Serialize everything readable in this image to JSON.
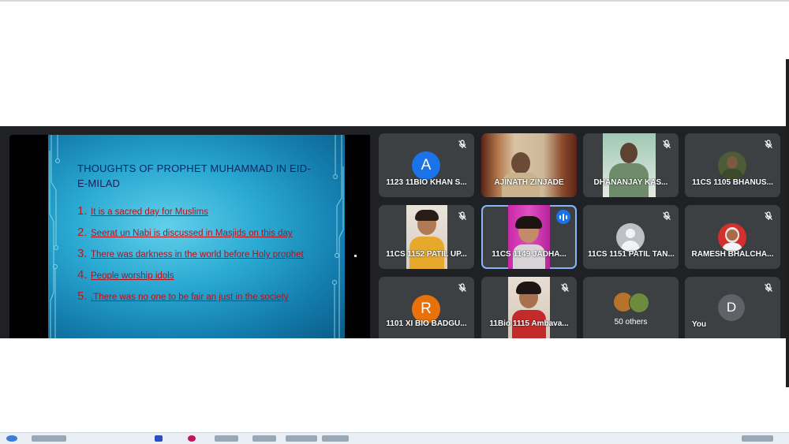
{
  "slide": {
    "title": "THOUGHTS OF PROPHET MUHAMMAD IN EID-E-MILAD",
    "points": [
      {
        "num": "1.",
        "text": "It is a sacred day for Muslims"
      },
      {
        "num": "2.",
        "text": "Seerat un Nabi is discussed in Masjids on this day"
      },
      {
        "num": "3.",
        "text": "There was darkness in the world before Holy prophet"
      },
      {
        "num": "4.",
        "text": "People worship idols"
      },
      {
        "num": "5.",
        "text": ".There was no one to be fair an just in the society"
      }
    ]
  },
  "participants": [
    {
      "name": "1123 11BIO KHAN S...",
      "initial": "A",
      "color": "#1a73e8",
      "muted": true
    },
    {
      "name": "AJINATH ZINJADE",
      "muted": false
    },
    {
      "name": "DHANANJAY KAS...",
      "muted": true
    },
    {
      "name": "11CS 1105 BHANUS...",
      "muted": true
    },
    {
      "name": "11CS 1152 PATIL UP...",
      "muted": true
    },
    {
      "name": "11CS 1149 JADHA...",
      "speaking": true
    },
    {
      "name": "11CS 1151 PATIL TAN...",
      "muted": true
    },
    {
      "name": "RAMESH BHALCHA...",
      "muted": true
    },
    {
      "name": "1101 XI BIO BADGU...",
      "initial": "R",
      "color": "#e8710a",
      "muted": true
    },
    {
      "name": "11Bio 1115 Ambava...",
      "muted": true
    },
    {
      "name": "50 others"
    },
    {
      "name": "You",
      "initial": "D",
      "color": "#5f6368",
      "muted": true
    }
  ],
  "icons": [
    "mic-off-icon",
    "speaking-indicator-icon",
    "default-avatar-icon"
  ]
}
